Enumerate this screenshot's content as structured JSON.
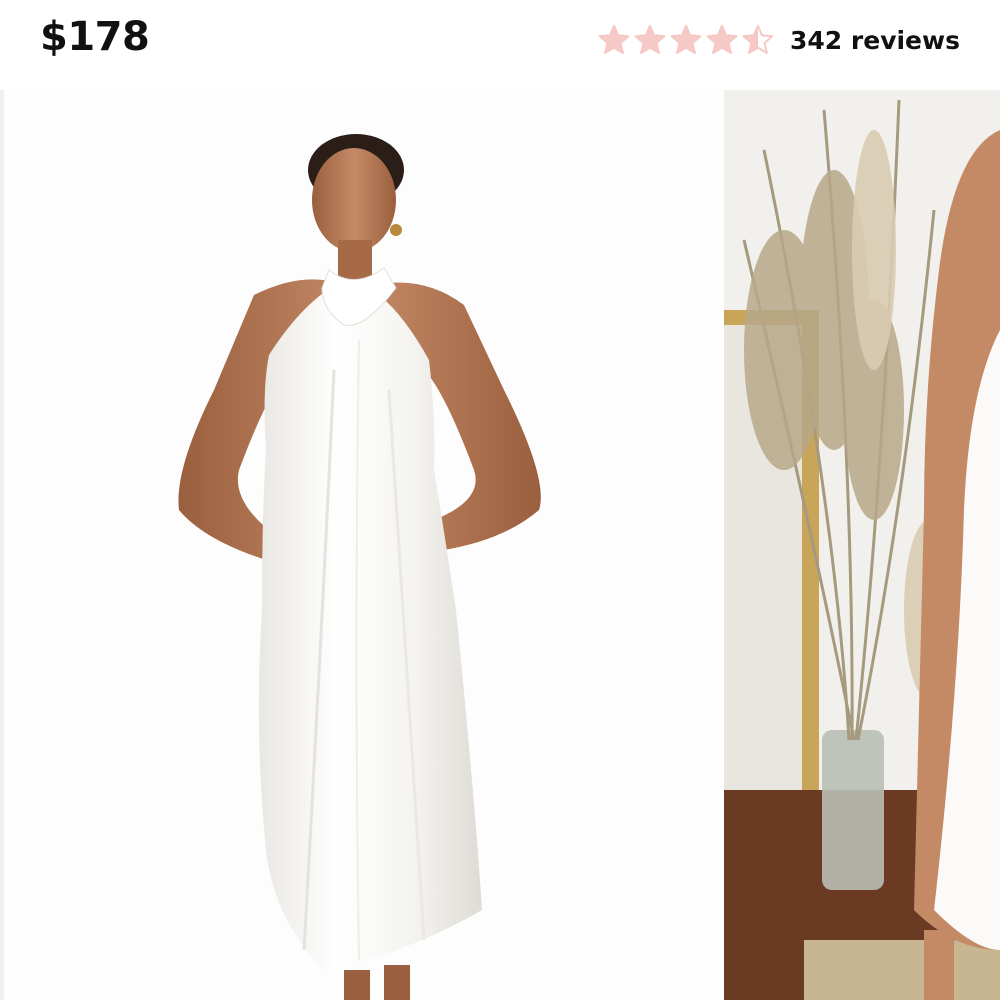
{
  "product": {
    "price": "$178",
    "rating": 4.5,
    "rating_max": 5,
    "reviews_label": "342 reviews"
  },
  "colors": {
    "star_fill": "#f6c9c6",
    "star_empty": "#ffffff",
    "star_outline": "#f6c9c6",
    "text": "#111111"
  },
  "icons": {
    "star": "star-icon",
    "half_star": "star-half-icon"
  },
  "gallery": {
    "images": [
      {
        "alt": "main-product-photo"
      },
      {
        "alt": "secondary-product-photo"
      }
    ]
  }
}
